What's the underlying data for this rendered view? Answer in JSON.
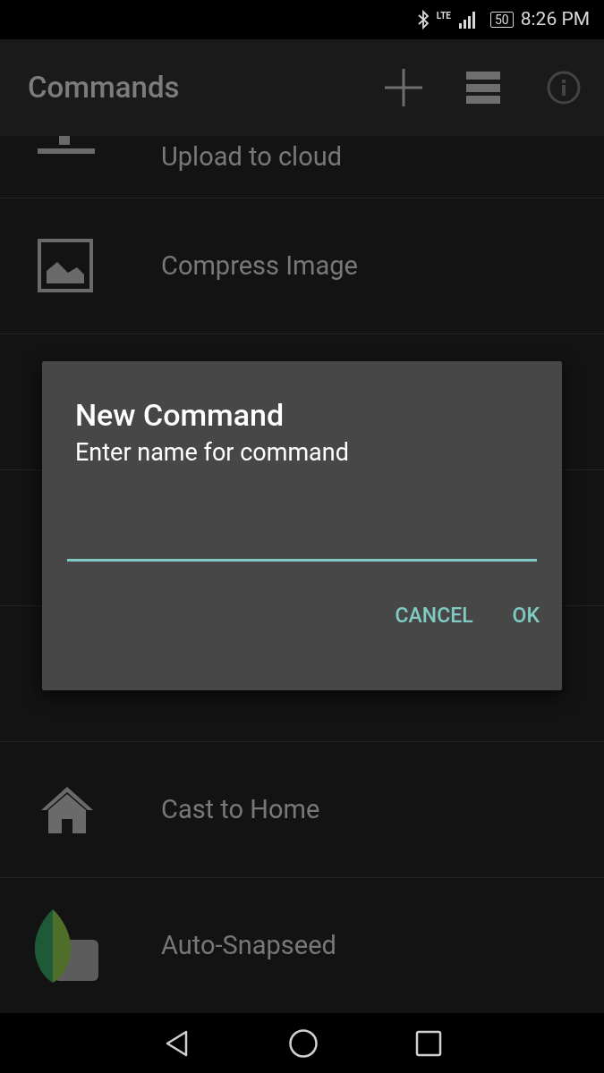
{
  "status_bar": {
    "network": "LTE",
    "battery": "50",
    "time": "8:26 PM"
  },
  "app_bar": {
    "title": "Commands"
  },
  "commands": [
    {
      "label": "Upload to cloud",
      "kind": "upload"
    },
    {
      "label": "Compress Image",
      "kind": "image"
    },
    {
      "kind": "hidden"
    },
    {
      "kind": "hidden"
    },
    {
      "kind": "hidden"
    },
    {
      "label": "Cast to Home",
      "kind": "home"
    },
    {
      "label": "Auto-Snapseed",
      "kind": "leaf"
    }
  ],
  "dialog": {
    "title": "New Command",
    "message": "Enter name for command",
    "field": {
      "focused": true
    },
    "buttons": [
      "CANCEL",
      "OK"
    ]
  }
}
